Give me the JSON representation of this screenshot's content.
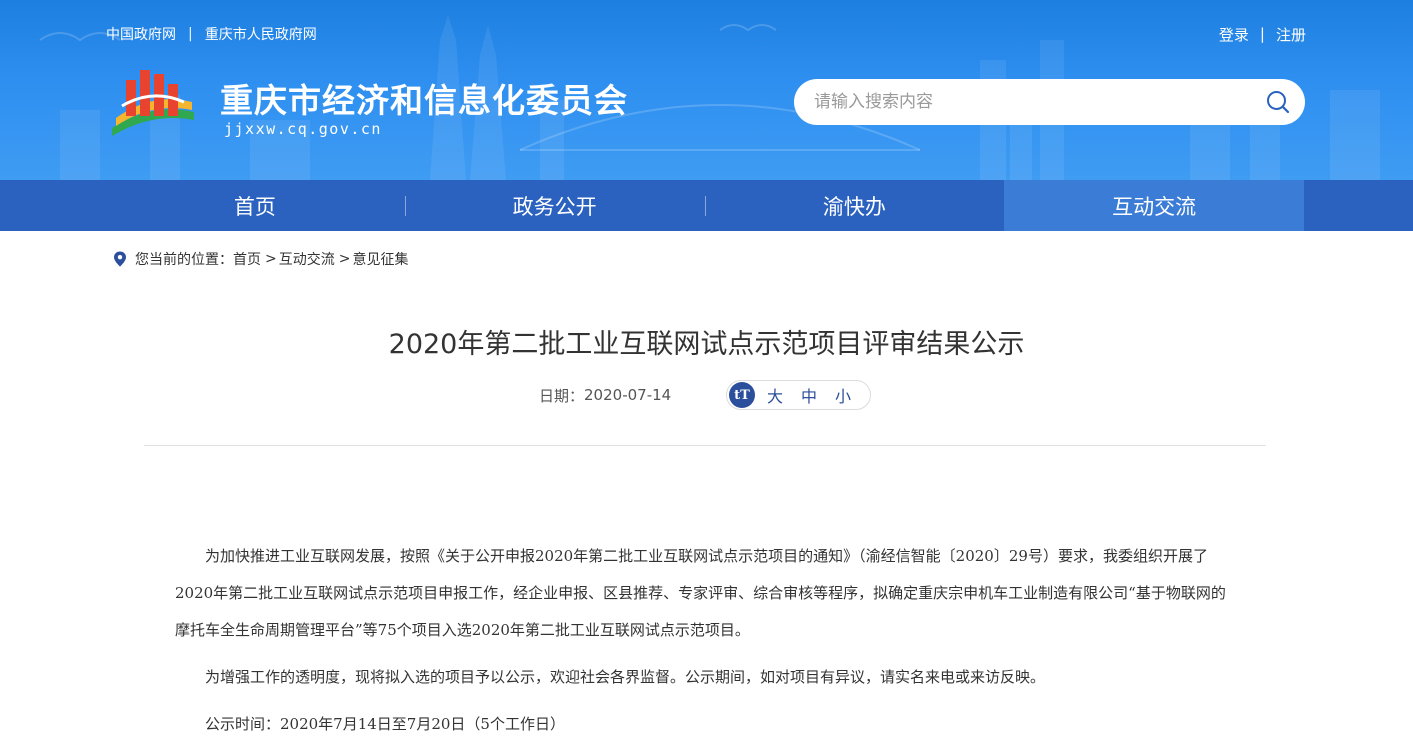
{
  "header": {
    "top_links": [
      "中国政府网",
      "重庆市人民政府网"
    ],
    "top_link_separator": "|",
    "auth": {
      "login": "登录",
      "separator": "|",
      "register": "注册"
    },
    "site_title": "重庆市经济和信息化委员会",
    "site_domain": "jjxxw.cq.gov.cn",
    "search": {
      "placeholder": "请输入搜索内容",
      "value": ""
    }
  },
  "nav": {
    "items": [
      {
        "label": "首页",
        "active": false
      },
      {
        "label": "政务公开",
        "active": false
      },
      {
        "label": "渝快办",
        "active": false
      },
      {
        "label": "互动交流",
        "active": true
      }
    ]
  },
  "breadcrumb": {
    "prefix": "您当前的位置：",
    "items": [
      "首页",
      "互动交流",
      "意见征集"
    ],
    "separator": ">"
  },
  "article": {
    "title": "2020年第二批工业互联网试点示范项目评审结果公示",
    "date_label": "日期：",
    "date": "2020-07-14",
    "font_size": {
      "badge": "tT",
      "large": "大",
      "medium": "中",
      "small": "小"
    },
    "paragraphs": [
      "为加快推进工业互联网发展，按照《关于公开申报2020年第二批工业互联网试点示范项目的通知》（渝经信智能〔2020〕29号）要求，我委组织开展了2020年第二批工业互联网试点示范项目申报工作，经企业申报、区县推荐、专家评审、综合审核等程序，拟确定重庆宗申机车工业制造有限公司“基于物联网的摩托车全生命周期管理平台”等75个项目入选2020年第二批工业互联网试点示范项目。",
      "为增强工作的透明度，现将拟入选的项目予以公示，欢迎社会各界监督。公示期间，如对项目有异议，请实名来电或来访反映。",
      "公示时间：2020年7月14日至7月20日（5个工作日）"
    ]
  },
  "colors": {
    "header_blue": "#2e8ff0",
    "nav_blue": "#2b62c0",
    "nav_active": "#3b7cd6",
    "accent_dark_blue": "#2b4f9c"
  }
}
